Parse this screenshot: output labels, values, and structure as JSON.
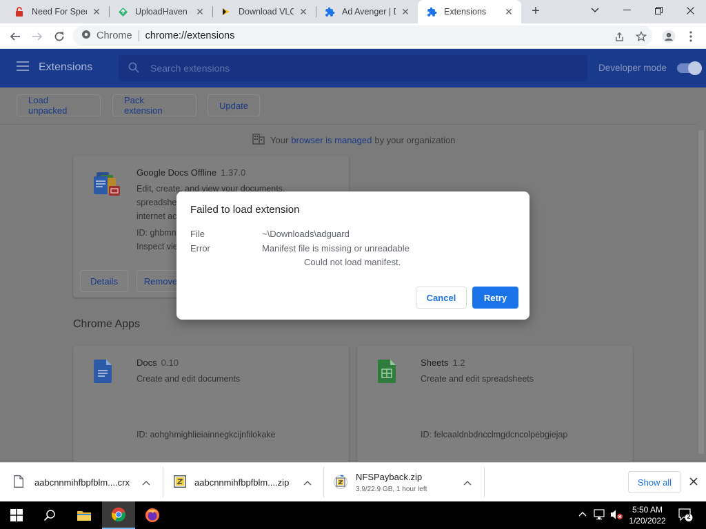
{
  "tabs": [
    {
      "title": "Need For Speed",
      "icon": "red-lock-icon"
    },
    {
      "title": "UploadHaven -",
      "icon": "uploadhaven-icon"
    },
    {
      "title": "Download VLO",
      "icon": "yellow-download-icon"
    },
    {
      "title": "Ad Avenger | Do",
      "icon": "puzzle-icon"
    },
    {
      "title": "Extensions",
      "icon": "puzzle-icon",
      "active": true
    }
  ],
  "toolbar": {
    "scheme_label": "Chrome",
    "url": "chrome://extensions"
  },
  "header": {
    "title": "Extensions",
    "search_placeholder": "Search extensions",
    "developer_mode_label": "Developer mode",
    "developer_mode_on": true
  },
  "actions": {
    "load_unpacked": "Load unpacked",
    "pack_extension": "Pack extension",
    "update": "Update"
  },
  "managed": {
    "prefix": "Your",
    "link": "browser is managed",
    "suffix": "by your organization"
  },
  "extensions": [
    {
      "name": "Google Docs Offline",
      "version": "1.37.0",
      "desc_lines": [
        "Edit, create, and view your documents,",
        "spreadshe",
        "internet ac"
      ],
      "id": "ID: ghbmn",
      "inspect": "Inspect vie",
      "details": "Details",
      "remove": "Remove"
    }
  ],
  "apps_section": {
    "title": "Chrome Apps",
    "apps": [
      {
        "name": "Docs",
        "version": "0.10",
        "desc": "Create and edit documents",
        "id": "ID: aohghmighlieiainnegkcijnfilokake"
      },
      {
        "name": "Sheets",
        "version": "1.2",
        "desc": "Create and edit spreadsheets",
        "id": "ID: felcaaldnbdncclmgdcncolpebgiejap"
      }
    ]
  },
  "dialog": {
    "title": "Failed to load extension",
    "file_label": "File",
    "file_value": "~\\Downloads\\adguard",
    "error_label": "Error",
    "error_value": "Manifest file is missing or unreadable",
    "error_detail": "Could not load manifest.",
    "cancel": "Cancel",
    "retry": "Retry"
  },
  "downloads": [
    {
      "name": "aabcnnmihfbpfblm....crx",
      "status": ""
    },
    {
      "name": "aabcnnmihfbpfblm....zip",
      "status": ""
    },
    {
      "name": "NFSPayback.zip",
      "status": "3.9/22.9 GB, 1 hour left"
    }
  ],
  "shelf": {
    "show_all": "Show all"
  },
  "taskbar": {
    "time": "5:50 AM",
    "date": "1/20/2022",
    "notification_count": "2"
  },
  "colors": {
    "accent": "#1a73e8",
    "header": "#1a3a8c"
  }
}
